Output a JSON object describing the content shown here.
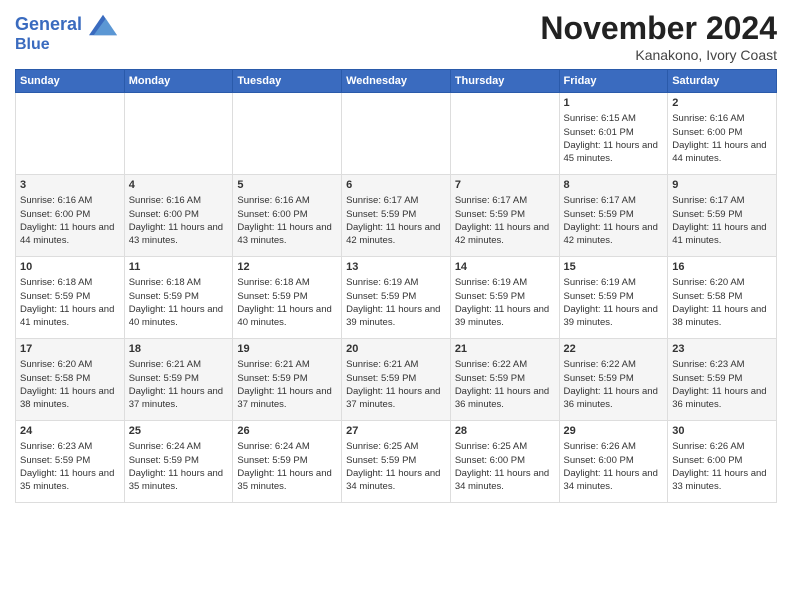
{
  "header": {
    "logo_line1": "General",
    "logo_line2": "Blue",
    "month_title": "November 2024",
    "location": "Kanakono, Ivory Coast"
  },
  "weekdays": [
    "Sunday",
    "Monday",
    "Tuesday",
    "Wednesday",
    "Thursday",
    "Friday",
    "Saturday"
  ],
  "weeks": [
    [
      {
        "day": "",
        "info": ""
      },
      {
        "day": "",
        "info": ""
      },
      {
        "day": "",
        "info": ""
      },
      {
        "day": "",
        "info": ""
      },
      {
        "day": "",
        "info": ""
      },
      {
        "day": "1",
        "info": "Sunrise: 6:15 AM\nSunset: 6:01 PM\nDaylight: 11 hours and 45 minutes."
      },
      {
        "day": "2",
        "info": "Sunrise: 6:16 AM\nSunset: 6:00 PM\nDaylight: 11 hours and 44 minutes."
      }
    ],
    [
      {
        "day": "3",
        "info": "Sunrise: 6:16 AM\nSunset: 6:00 PM\nDaylight: 11 hours and 44 minutes."
      },
      {
        "day": "4",
        "info": "Sunrise: 6:16 AM\nSunset: 6:00 PM\nDaylight: 11 hours and 43 minutes."
      },
      {
        "day": "5",
        "info": "Sunrise: 6:16 AM\nSunset: 6:00 PM\nDaylight: 11 hours and 43 minutes."
      },
      {
        "day": "6",
        "info": "Sunrise: 6:17 AM\nSunset: 5:59 PM\nDaylight: 11 hours and 42 minutes."
      },
      {
        "day": "7",
        "info": "Sunrise: 6:17 AM\nSunset: 5:59 PM\nDaylight: 11 hours and 42 minutes."
      },
      {
        "day": "8",
        "info": "Sunrise: 6:17 AM\nSunset: 5:59 PM\nDaylight: 11 hours and 42 minutes."
      },
      {
        "day": "9",
        "info": "Sunrise: 6:17 AM\nSunset: 5:59 PM\nDaylight: 11 hours and 41 minutes."
      }
    ],
    [
      {
        "day": "10",
        "info": "Sunrise: 6:18 AM\nSunset: 5:59 PM\nDaylight: 11 hours and 41 minutes."
      },
      {
        "day": "11",
        "info": "Sunrise: 6:18 AM\nSunset: 5:59 PM\nDaylight: 11 hours and 40 minutes."
      },
      {
        "day": "12",
        "info": "Sunrise: 6:18 AM\nSunset: 5:59 PM\nDaylight: 11 hours and 40 minutes."
      },
      {
        "day": "13",
        "info": "Sunrise: 6:19 AM\nSunset: 5:59 PM\nDaylight: 11 hours and 39 minutes."
      },
      {
        "day": "14",
        "info": "Sunrise: 6:19 AM\nSunset: 5:59 PM\nDaylight: 11 hours and 39 minutes."
      },
      {
        "day": "15",
        "info": "Sunrise: 6:19 AM\nSunset: 5:59 PM\nDaylight: 11 hours and 39 minutes."
      },
      {
        "day": "16",
        "info": "Sunrise: 6:20 AM\nSunset: 5:58 PM\nDaylight: 11 hours and 38 minutes."
      }
    ],
    [
      {
        "day": "17",
        "info": "Sunrise: 6:20 AM\nSunset: 5:58 PM\nDaylight: 11 hours and 38 minutes."
      },
      {
        "day": "18",
        "info": "Sunrise: 6:21 AM\nSunset: 5:59 PM\nDaylight: 11 hours and 37 minutes."
      },
      {
        "day": "19",
        "info": "Sunrise: 6:21 AM\nSunset: 5:59 PM\nDaylight: 11 hours and 37 minutes."
      },
      {
        "day": "20",
        "info": "Sunrise: 6:21 AM\nSunset: 5:59 PM\nDaylight: 11 hours and 37 minutes."
      },
      {
        "day": "21",
        "info": "Sunrise: 6:22 AM\nSunset: 5:59 PM\nDaylight: 11 hours and 36 minutes."
      },
      {
        "day": "22",
        "info": "Sunrise: 6:22 AM\nSunset: 5:59 PM\nDaylight: 11 hours and 36 minutes."
      },
      {
        "day": "23",
        "info": "Sunrise: 6:23 AM\nSunset: 5:59 PM\nDaylight: 11 hours and 36 minutes."
      }
    ],
    [
      {
        "day": "24",
        "info": "Sunrise: 6:23 AM\nSunset: 5:59 PM\nDaylight: 11 hours and 35 minutes."
      },
      {
        "day": "25",
        "info": "Sunrise: 6:24 AM\nSunset: 5:59 PM\nDaylight: 11 hours and 35 minutes."
      },
      {
        "day": "26",
        "info": "Sunrise: 6:24 AM\nSunset: 5:59 PM\nDaylight: 11 hours and 35 minutes."
      },
      {
        "day": "27",
        "info": "Sunrise: 6:25 AM\nSunset: 5:59 PM\nDaylight: 11 hours and 34 minutes."
      },
      {
        "day": "28",
        "info": "Sunrise: 6:25 AM\nSunset: 6:00 PM\nDaylight: 11 hours and 34 minutes."
      },
      {
        "day": "29",
        "info": "Sunrise: 6:26 AM\nSunset: 6:00 PM\nDaylight: 11 hours and 34 minutes."
      },
      {
        "day": "30",
        "info": "Sunrise: 6:26 AM\nSunset: 6:00 PM\nDaylight: 11 hours and 33 minutes."
      }
    ]
  ]
}
